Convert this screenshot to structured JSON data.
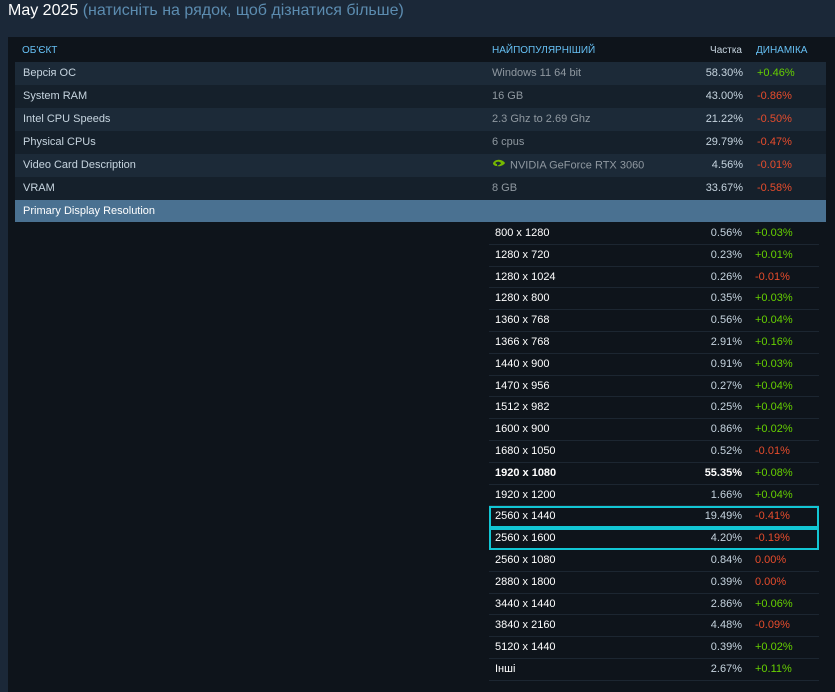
{
  "header": {
    "month": "May 2025",
    "hint": "(натисніть на рядок, щоб дізнатися більше)"
  },
  "columns": {
    "object": "ОБ'ЄКТ",
    "popular": "НАЙПОПУЛЯРНІШИЙ",
    "share": "Частка",
    "dynamics": "ДИНАМІКА"
  },
  "rows": [
    {
      "name": "Версія ОС",
      "popular": "Windows 11 64 bit",
      "share": "58.30%",
      "change": "+0.46%",
      "trend": "pos"
    },
    {
      "name": "System RAM",
      "popular": "16 GB",
      "share": "43.00%",
      "change": "-0.86%",
      "trend": "neg"
    },
    {
      "name": "Intel CPU Speeds",
      "popular": "2.3 Ghz to 2.69 Ghz",
      "share": "21.22%",
      "change": "-0.50%",
      "trend": "neg"
    },
    {
      "name": "Physical CPUs",
      "popular": "6 cpus",
      "share": "29.79%",
      "change": "-0.47%",
      "trend": "neg"
    },
    {
      "name": "Video Card Description",
      "popular": "NVIDIA GeForce RTX 3060",
      "share": "4.56%",
      "change": "-0.01%",
      "trend": "neg",
      "icon": "nvidia-logo-icon"
    },
    {
      "name": "VRAM",
      "popular": "8 GB",
      "share": "33.67%",
      "change": "-0.58%",
      "trend": "neg"
    }
  ],
  "section": {
    "title": "Primary Display Resolution"
  },
  "resolutions": [
    {
      "res": "800 x 1280",
      "share": "0.56%",
      "change": "+0.03%",
      "trend": "pos"
    },
    {
      "res": "1280 x 720",
      "share": "0.23%",
      "change": "+0.01%",
      "trend": "pos"
    },
    {
      "res": "1280 x 1024",
      "share": "0.26%",
      "change": "-0.01%",
      "trend": "neg"
    },
    {
      "res": "1280 x 800",
      "share": "0.35%",
      "change": "+0.03%",
      "trend": "pos"
    },
    {
      "res": "1360 x 768",
      "share": "0.56%",
      "change": "+0.04%",
      "trend": "pos"
    },
    {
      "res": "1366 x 768",
      "share": "2.91%",
      "change": "+0.16%",
      "trend": "pos"
    },
    {
      "res": "1440 x 900",
      "share": "0.91%",
      "change": "+0.03%",
      "trend": "pos"
    },
    {
      "res": "1470 x 956",
      "share": "0.27%",
      "change": "+0.04%",
      "trend": "pos"
    },
    {
      "res": "1512 x 982",
      "share": "0.25%",
      "change": "+0.04%",
      "trend": "pos"
    },
    {
      "res": "1600 x 900",
      "share": "0.86%",
      "change": "+0.02%",
      "trend": "pos"
    },
    {
      "res": "1680 x 1050",
      "share": "0.52%",
      "change": "-0.01%",
      "trend": "neg"
    },
    {
      "res": "1920 x 1080",
      "share": "55.35%",
      "change": "+0.08%",
      "trend": "pos",
      "bold": true
    },
    {
      "res": "1920 x 1200",
      "share": "1.66%",
      "change": "+0.04%",
      "trend": "pos"
    },
    {
      "res": "2560 x 1440",
      "share": "19.49%",
      "change": "-0.41%",
      "trend": "neg",
      "highlight": true
    },
    {
      "res": "2560 x 1600",
      "share": "4.20%",
      "change": "-0.19%",
      "trend": "neg",
      "highlight": true
    },
    {
      "res": "2560 x 1080",
      "share": "0.84%",
      "change": "0.00%",
      "trend": "neg"
    },
    {
      "res": "2880 x 1800",
      "share": "0.39%",
      "change": "0.00%",
      "trend": "neg"
    },
    {
      "res": "3440 x 1440",
      "share": "2.86%",
      "change": "+0.06%",
      "trend": "pos"
    },
    {
      "res": "3840 x 2160",
      "share": "4.48%",
      "change": "-0.09%",
      "trend": "neg"
    },
    {
      "res": "5120 x 1440",
      "share": "0.39%",
      "change": "+0.02%",
      "trend": "pos"
    },
    {
      "res": "Інші",
      "share": "2.67%",
      "change": "+0.11%",
      "trend": "pos"
    }
  ],
  "colors": {
    "positive": "#66d000",
    "negative": "#e74c2c",
    "highlight_outline": "#12c6d4",
    "section_bg": "#4a7191"
  }
}
